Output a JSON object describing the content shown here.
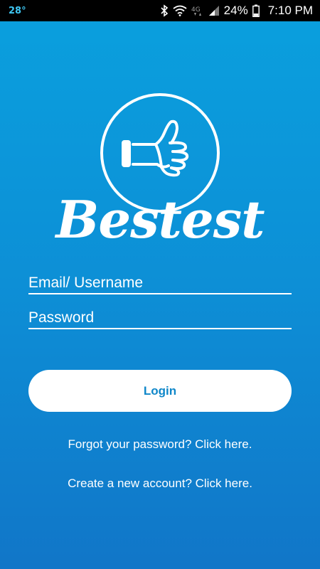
{
  "status_bar": {
    "temperature": "28°",
    "icons": [
      "bluetooth-icon",
      "wifi-icon",
      "4g-icon",
      "signal-icon",
      "battery-icon"
    ],
    "network": "4G",
    "battery": "24%",
    "time": "7:10 PM"
  },
  "brand": {
    "name": "Bestest",
    "logo_icon": "thumbs-up-icon"
  },
  "form": {
    "email_placeholder": "Email/ Username",
    "password_placeholder": "Password",
    "login_label": "Login"
  },
  "links": {
    "forgot": "Forgot your password? Click here.",
    "create": "Create a new account? Click here."
  },
  "colors": {
    "background_top": "#0aa0de",
    "background_bottom": "#1176c8",
    "button_text": "#0f87c9",
    "status_temp": "#3ec6f2"
  }
}
